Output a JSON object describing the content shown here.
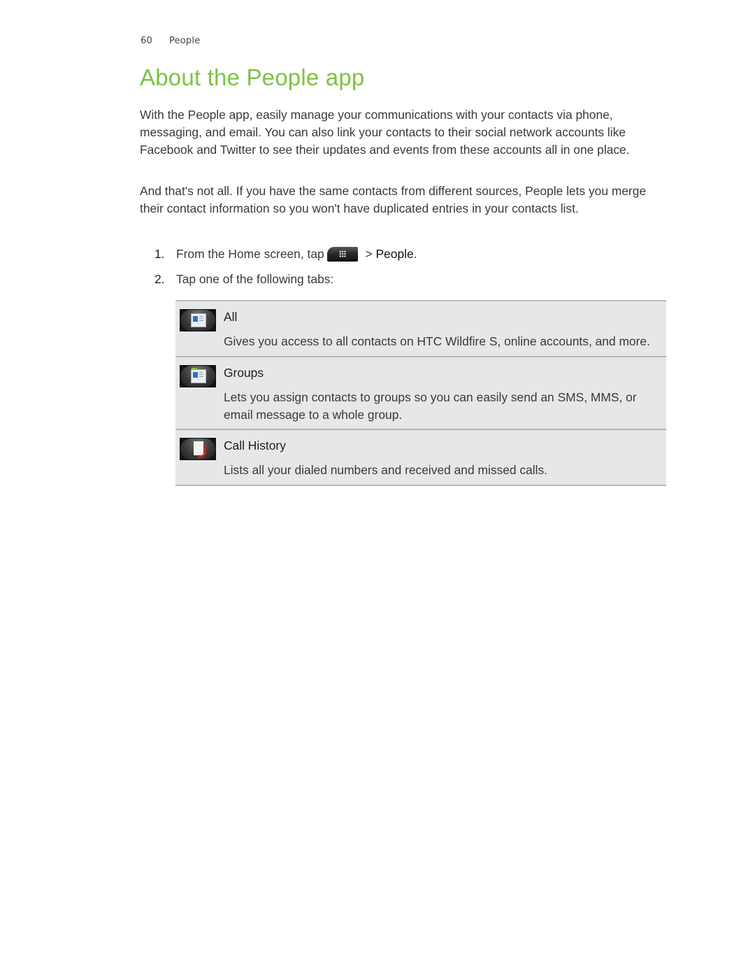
{
  "running_header": {
    "page_number": "60",
    "section": "People"
  },
  "title": "About the People app",
  "paragraphs": [
    "With the People app, easily manage your communications with your contacts via phone, messaging, and email. You can also link your contacts to their social network accounts like Facebook and Twitter to see their updates and events from these accounts all in one place.",
    "And that's not all. If you have the same contacts from different sources, People lets you merge their contact information so you won't have duplicated entries in your contacts list."
  ],
  "steps": [
    {
      "number": "1.",
      "text_before": "From the Home screen, tap",
      "icon": "all-apps-launcher-icon",
      "text_after": " > ",
      "ui_target": "People",
      "trailing": "."
    },
    {
      "number": "2.",
      "text": "Tap one of the following tabs:"
    }
  ],
  "tabs": [
    {
      "icon": "all-contacts-tab-icon",
      "label": "All",
      "description": "Gives you access to all contacts on HTC Wildfire S, online accounts, and more."
    },
    {
      "icon": "groups-tab-icon",
      "label": "Groups",
      "description": "Lets you assign contacts to groups so you can easily send an SMS, MMS, or email message to a whole group."
    },
    {
      "icon": "call-history-tab-icon",
      "label": "Call History",
      "description": "Lists all your dialed numbers and received and missed calls."
    }
  ],
  "colors": {
    "title_green": "#7dc243",
    "table_bg": "#e6e7e9",
    "table_border": "#b5b6b8"
  }
}
